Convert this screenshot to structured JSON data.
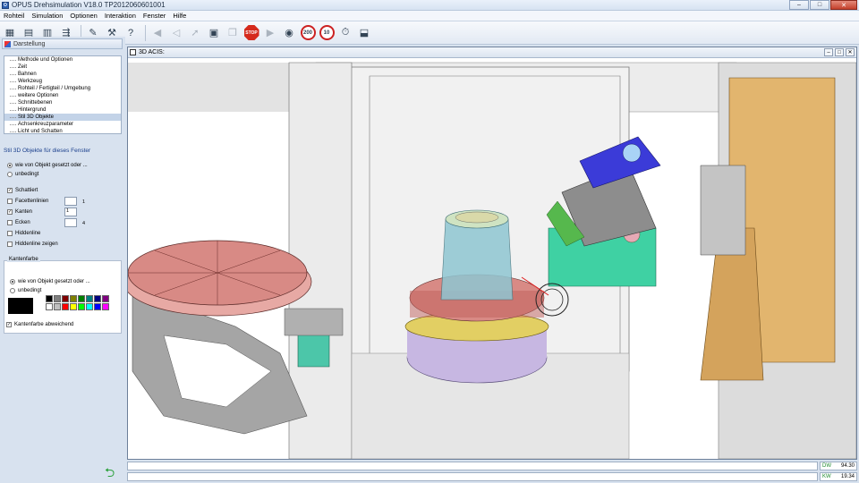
{
  "window": {
    "title": "OPUS Drehsimulation V18.0  TP2012060601001",
    "icon": "app-icon"
  },
  "menu": [
    "Rohteil",
    "Simulation",
    "Optionen",
    "Interaktion",
    "Fenster",
    "Hilfe"
  ],
  "toolbar": {
    "stop_label": "STOP",
    "speed_200": "200",
    "speed_10": "10"
  },
  "left_panel": {
    "header": "Darstellung",
    "tree": [
      "Methode und Optionen",
      "Zeit",
      "Bahnen",
      "Werkzeug",
      "Rohteil / Fertigteil / Umgebung",
      "weitere Optionen",
      "Schnittebenen",
      "Hintergrund",
      "Stil 3D Objekte",
      "Achsenkreuzparameter",
      "Licht und Schatten"
    ],
    "selected_index": 8,
    "section_title": "Stil 3D Objekte für dieses Fenster",
    "radio_objekt": "wie von Objekt gesetzt oder ...",
    "radio_unbedingt": "unbedingt",
    "checks": {
      "schattiert": "Schattiert",
      "facettenlinien": "Facettenlinien",
      "kanten": "Kanten",
      "ecken": "Ecken",
      "hiddenline": "Hiddenline",
      "hiddenline_zeigen": "Hiddenline zeigen"
    },
    "facetten_value": "1",
    "kanten_value": "1",
    "ecken_value": "4",
    "kantenfarbe": {
      "title": "Kantenfarbe",
      "radio_objekt": "wie von Objekt gesetzt oder ...",
      "radio_unbedingt": "unbedingt",
      "selected_color": "#000000",
      "palette": [
        "#000000",
        "#7f7f7f",
        "#800000",
        "#808000",
        "#008000",
        "#008080",
        "#000080",
        "#800080",
        "#ffffff",
        "#c0c0c0",
        "#ff0000",
        "#ffff00",
        "#00ff00",
        "#00ffff",
        "#0000ff",
        "#ff00ff"
      ],
      "abweichend_label": "Kantenfarbe abweichend"
    }
  },
  "viewport": {
    "title": "3D ACIS:"
  },
  "status": {
    "dw_label": "DW",
    "dw_value": "94.30",
    "kw_label": "KW",
    "kw_value": "19.34"
  }
}
